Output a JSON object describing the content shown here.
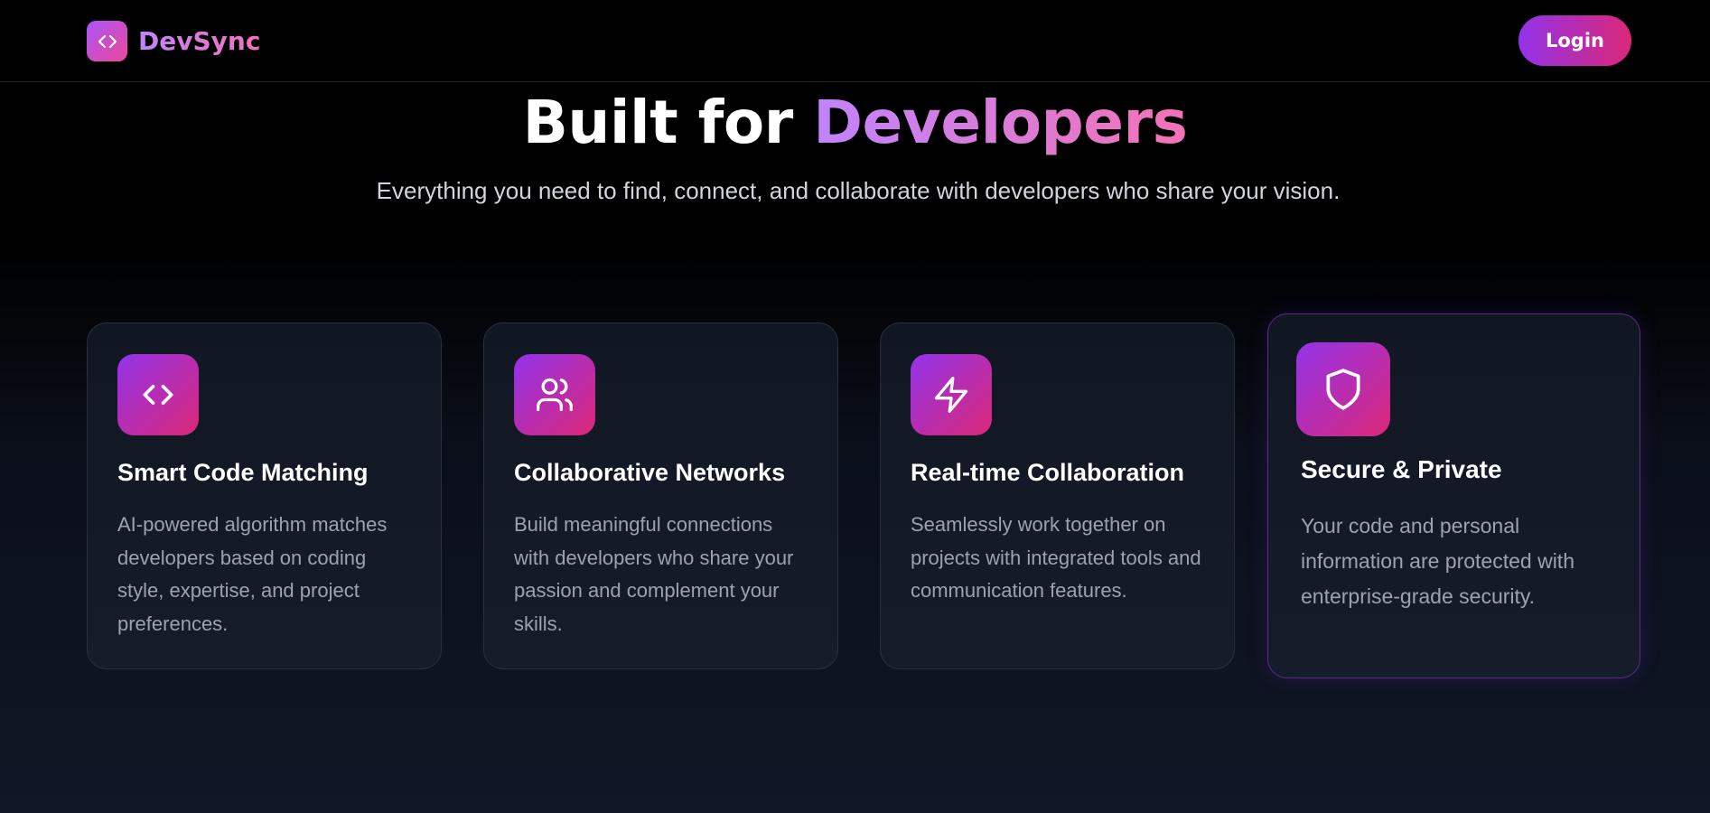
{
  "header": {
    "brand": "DevSync",
    "login_label": "Login"
  },
  "hero": {
    "title_plain": "Built for ",
    "title_accent": "Developers",
    "subtitle": "Everything you need to find, connect, and collaborate with developers who share your vision."
  },
  "features": [
    {
      "icon": "code-icon",
      "title": "Smart Code Matching",
      "description": "AI-powered algorithm matches developers based on coding style, expertise, and project preferences."
    },
    {
      "icon": "users-icon",
      "title": "Collaborative Networks",
      "description": "Build meaningful connections with developers who share your passion and complement your skills."
    },
    {
      "icon": "lightning-icon",
      "title": "Real-time Collaboration",
      "description": "Seamlessly work together on projects with integrated tools and communication features."
    },
    {
      "icon": "shield-icon",
      "title": "Secure & Private",
      "description": "Your code and personal information are protected with enterprise-grade security."
    }
  ],
  "colors": {
    "accent_start": "#9333ea",
    "accent_end": "#db2777",
    "background": "#000000",
    "card_background": "#131a27"
  }
}
